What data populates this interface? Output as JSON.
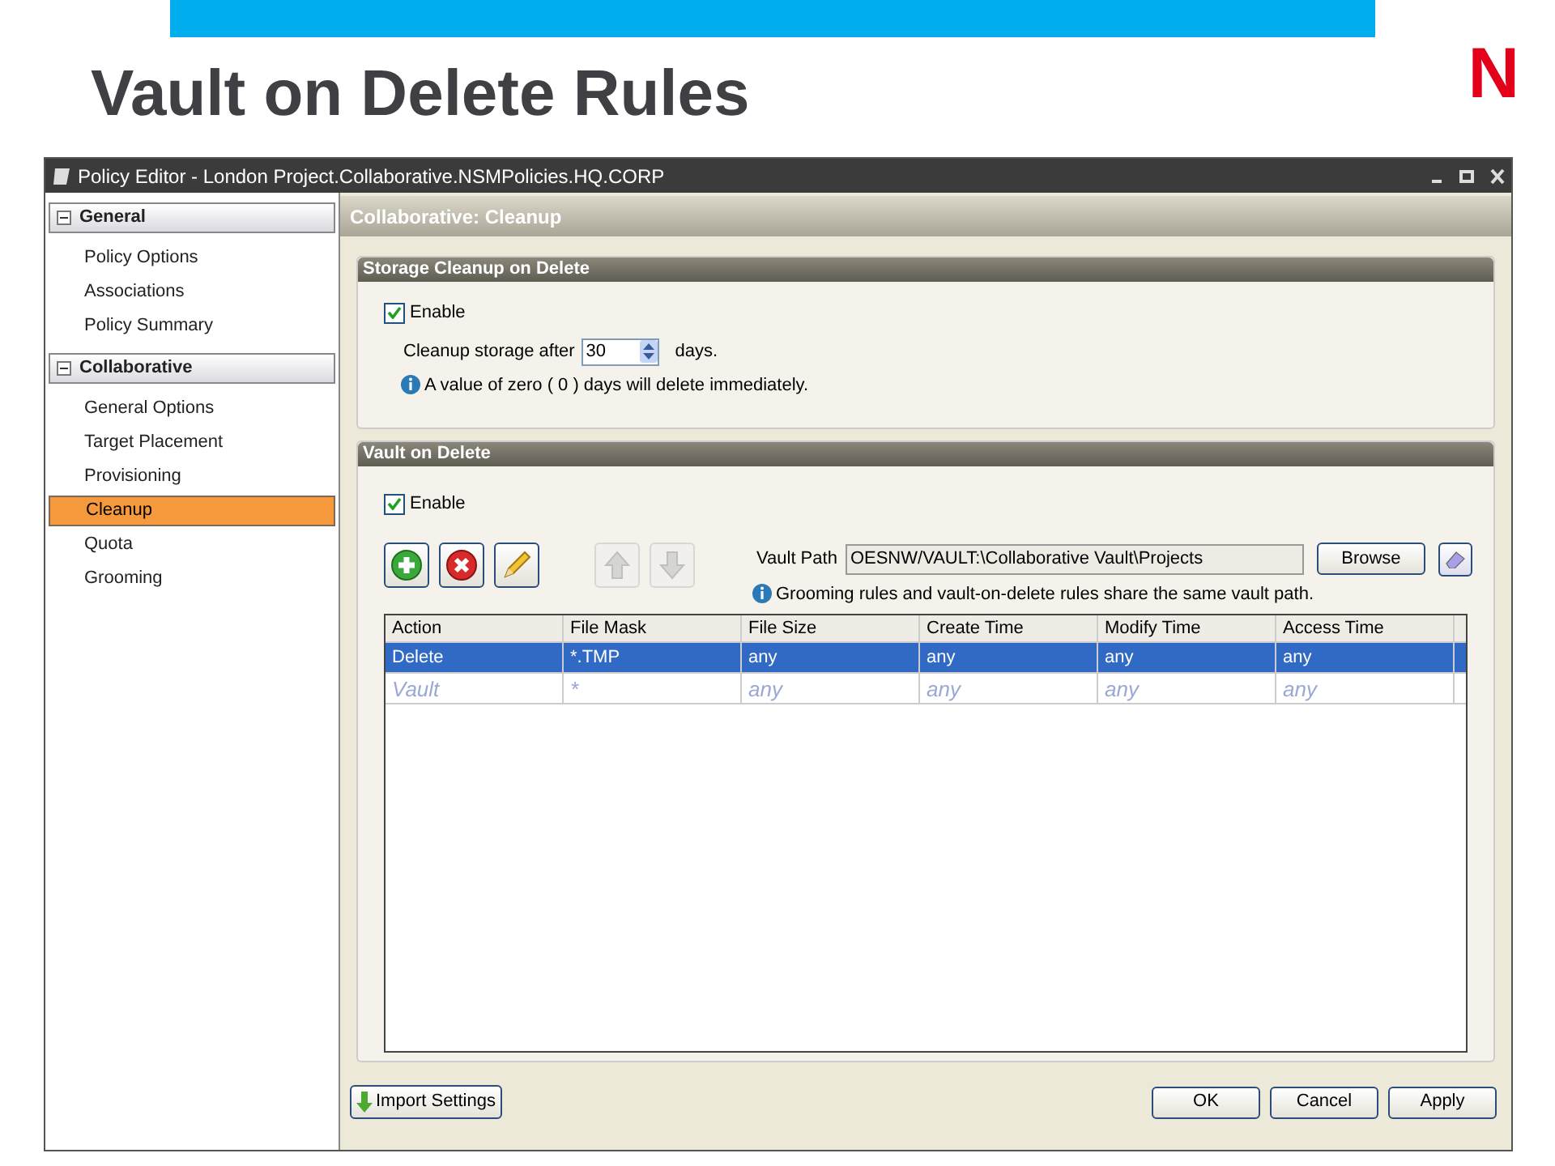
{
  "slide": {
    "title": "Vault on Delete Rules",
    "logo": "N"
  },
  "window": {
    "title": "Policy Editor - London Project.Collaborative.NSMPolicies.HQ.CORP"
  },
  "sidebar": {
    "groups": [
      {
        "label": "General",
        "expanded": true,
        "children": [
          {
            "label": "Policy Options",
            "selected": false
          },
          {
            "label": "Associations",
            "selected": false
          },
          {
            "label": "Policy Summary",
            "selected": false
          }
        ]
      },
      {
        "label": "Collaborative",
        "expanded": true,
        "children": [
          {
            "label": "General Options",
            "selected": false
          },
          {
            "label": "Target Placement",
            "selected": false
          },
          {
            "label": "Provisioning",
            "selected": false
          },
          {
            "label": "Cleanup",
            "selected": true
          },
          {
            "label": "Quota",
            "selected": false
          },
          {
            "label": "Grooming",
            "selected": false
          }
        ]
      }
    ]
  },
  "content": {
    "title": "Collaborative: Cleanup",
    "storage_cleanup": {
      "title": "Storage Cleanup on Delete",
      "enable": {
        "label": "Enable",
        "checked": true
      },
      "cleanup_label": "Cleanup storage after",
      "days_value": "30",
      "days_suffix": "days.",
      "note": "A value of zero ( 0 ) days will delete immediately."
    },
    "vault_on_delete": {
      "title": "Vault on Delete",
      "enable": {
        "label": "Enable",
        "checked": true
      },
      "toolbar": [
        {
          "kind": "add",
          "disabled": false
        },
        {
          "kind": "remove",
          "disabled": false
        },
        {
          "kind": "edit",
          "disabled": false
        },
        {
          "kind": "up",
          "disabled": true
        },
        {
          "kind": "down",
          "disabled": true
        }
      ],
      "vault_path_label": "Vault Path",
      "vault_path_value": "OESNW/VAULT:\\Collaborative Vault\\Projects",
      "browse_button": "Browse",
      "note": "Grooming rules and vault-on-delete rules share the same vault path.",
      "table": {
        "columns": [
          "Action",
          "File Mask",
          "File Size",
          "Create Time",
          "Modify Time",
          "Access Time"
        ],
        "rows": [
          {
            "kind": "rule",
            "selected": true,
            "cells": [
              "Delete",
              "*.TMP",
              "any",
              "any",
              "any",
              "any"
            ]
          },
          {
            "kind": "new_row_hint",
            "selected": false,
            "cells": [
              "Vault",
              "*",
              "any",
              "any",
              "any",
              "any"
            ]
          }
        ]
      }
    }
  },
  "footer": {
    "import_button": "Import Settings",
    "buttons": [
      "OK",
      "Cancel",
      "Apply"
    ]
  }
}
